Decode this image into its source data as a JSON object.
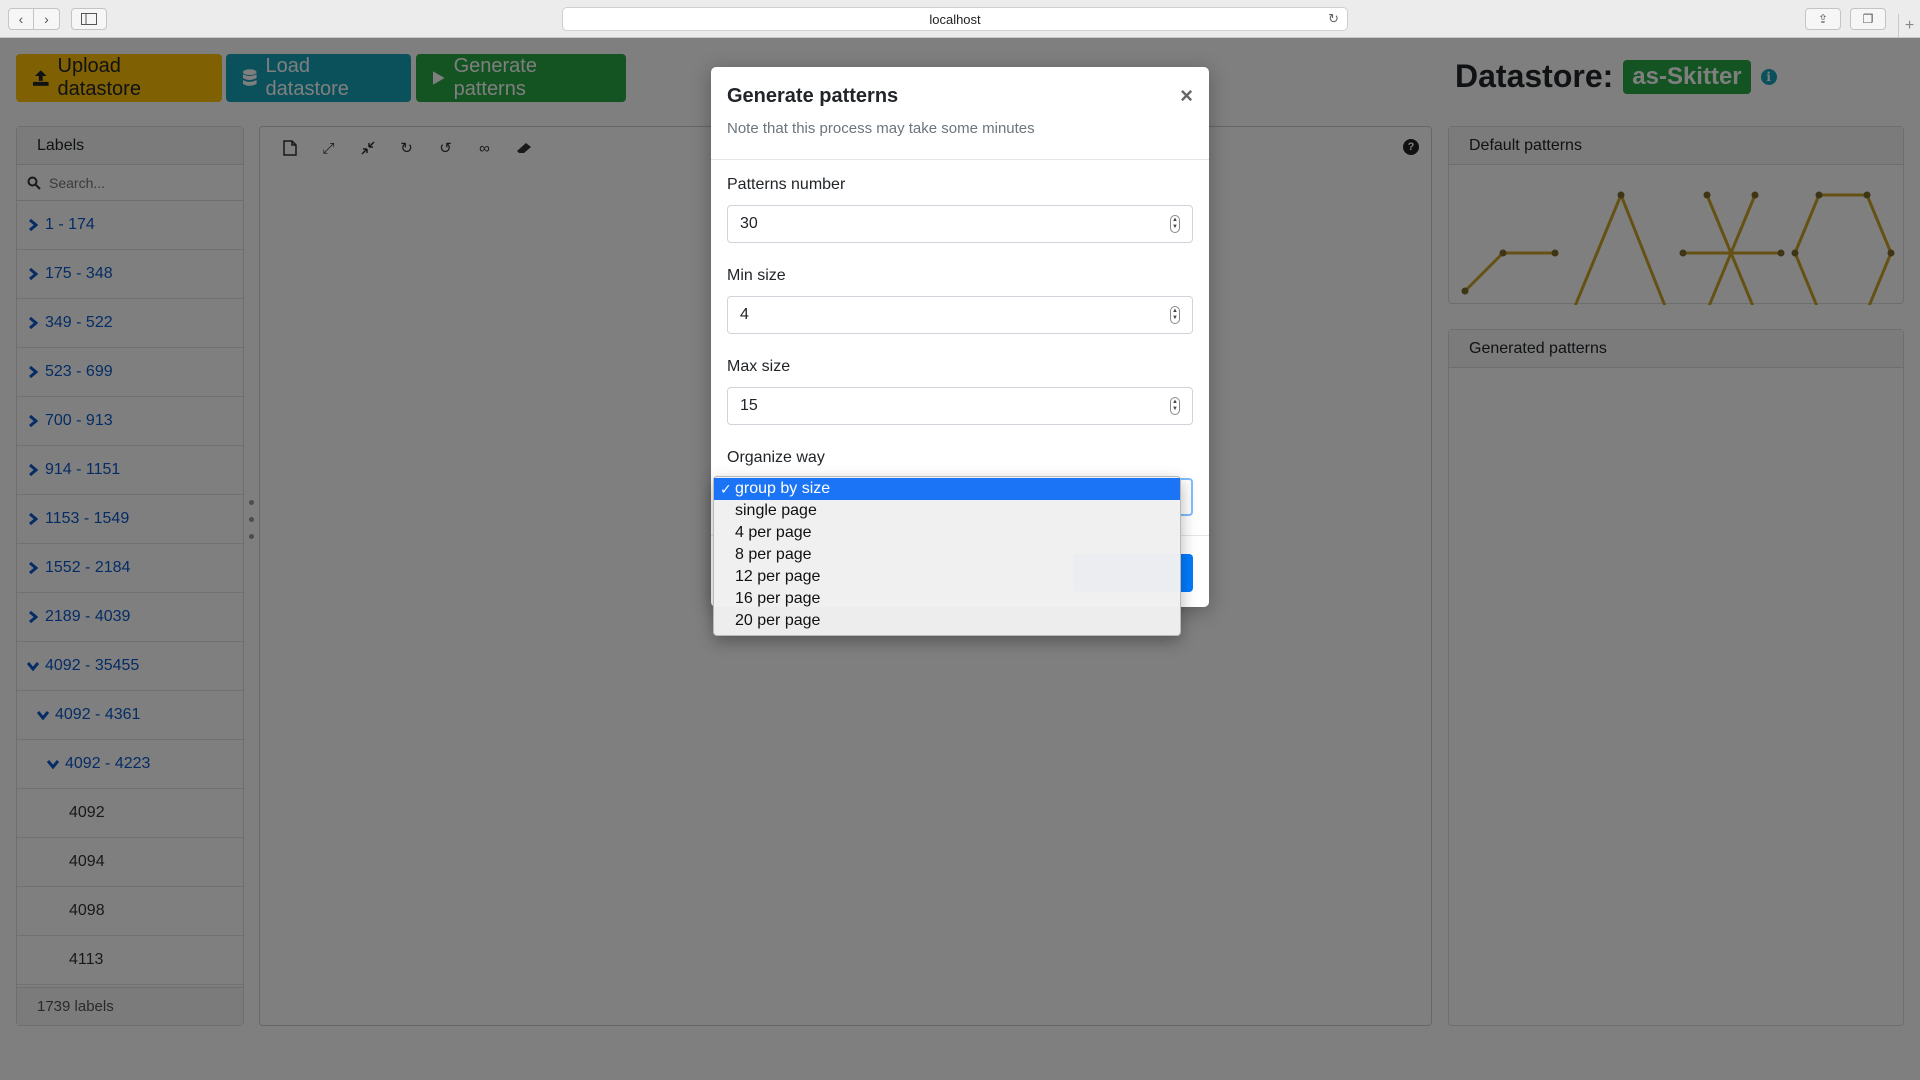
{
  "browser": {
    "url": "localhost"
  },
  "toolbar": {
    "upload_label": "Upload datastore",
    "load_label": "Load datastore",
    "generate_label": "Generate patterns"
  },
  "datastore": {
    "label": "Datastore:",
    "name": "as-Skitter"
  },
  "labels_panel": {
    "title": "Labels",
    "search_placeholder": "Search...",
    "items": [
      {
        "label": "1 - 174",
        "expanded": false,
        "level": 0
      },
      {
        "label": "175 - 348",
        "expanded": false,
        "level": 0
      },
      {
        "label": "349 - 522",
        "expanded": false,
        "level": 0
      },
      {
        "label": "523 - 699",
        "expanded": false,
        "level": 0
      },
      {
        "label": "700 - 913",
        "expanded": false,
        "level": 0
      },
      {
        "label": "914 - 1151",
        "expanded": false,
        "level": 0
      },
      {
        "label": "1153 - 1549",
        "expanded": false,
        "level": 0
      },
      {
        "label": "1552 - 2184",
        "expanded": false,
        "level": 0
      },
      {
        "label": "2189 - 4039",
        "expanded": false,
        "level": 0
      },
      {
        "label": "4092 - 35455",
        "expanded": true,
        "level": 0
      },
      {
        "label": "4092 - 4361",
        "expanded": true,
        "level": 1
      },
      {
        "label": "4092 - 4223",
        "expanded": true,
        "level": 2
      },
      {
        "label": "4092",
        "leaf": true
      },
      {
        "label": "4094",
        "leaf": true
      },
      {
        "label": "4098",
        "leaf": true
      },
      {
        "label": "4113",
        "leaf": true
      }
    ],
    "footer": "1739 labels"
  },
  "right": {
    "default_title": "Default patterns",
    "generated_title": "Generated patterns"
  },
  "modal": {
    "title": "Generate patterns",
    "subtitle": "Note that this process may take some minutes",
    "close": "×",
    "patterns_number_label": "Patterns number",
    "patterns_number": "30",
    "min_size_label": "Min size",
    "min_size": "4",
    "max_size_label": "Max size",
    "max_size": "15",
    "organize_label": "Organize way",
    "organize_options": [
      "group by size",
      "single page",
      "4 per page",
      "8 per page",
      "12 per page",
      "16 per page",
      "20 per page"
    ],
    "organize_selected": "group by size"
  },
  "colors": {
    "yellow": "#ffc107",
    "teal": "#17a2b8",
    "green": "#28a745",
    "blue": "#007bff",
    "pattern": "#c9a227"
  }
}
